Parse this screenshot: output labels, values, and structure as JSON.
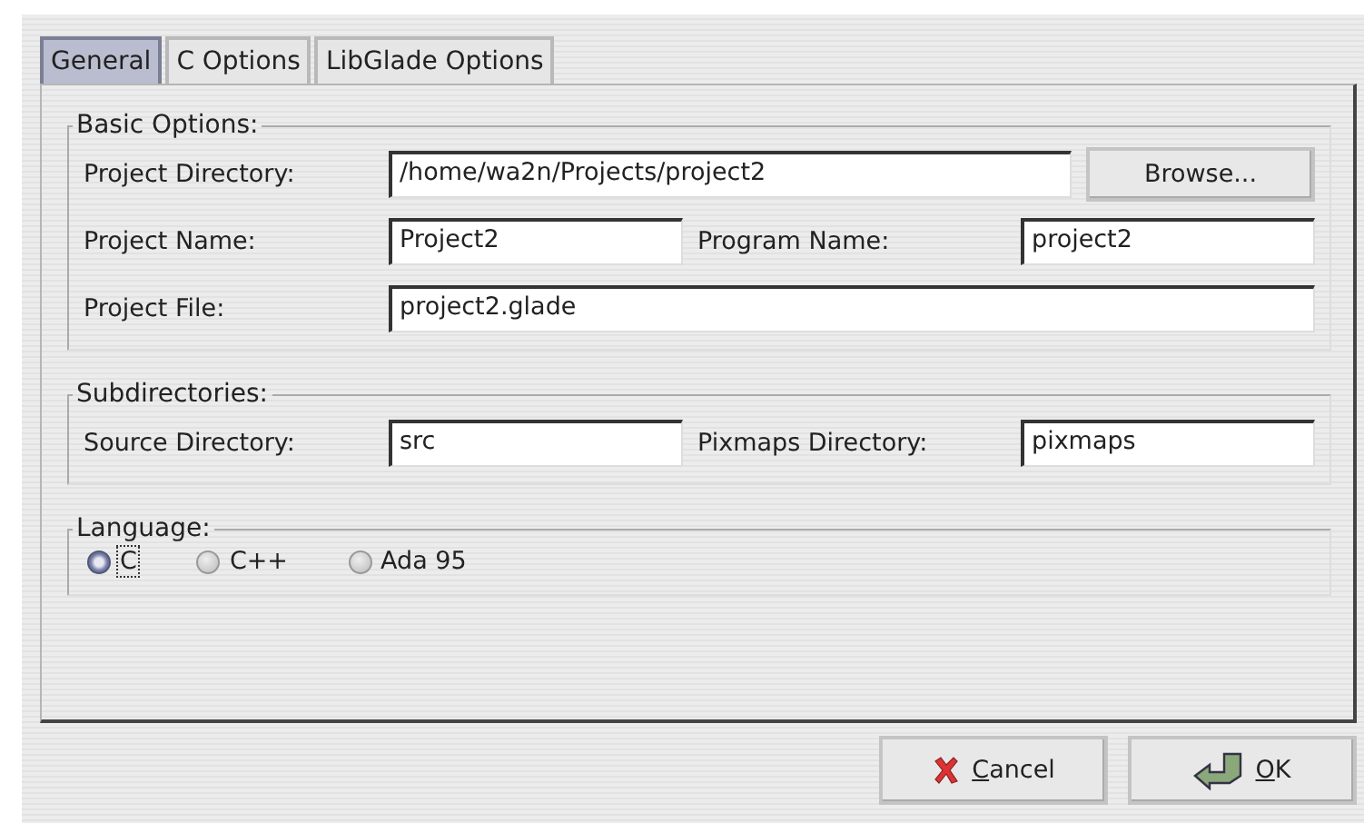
{
  "tabs": [
    {
      "label": "General",
      "selected": true
    },
    {
      "label": "C Options",
      "selected": false
    },
    {
      "label": "LibGlade Options",
      "selected": false
    }
  ],
  "basic_options": {
    "title": "Basic Options:",
    "project_directory": {
      "label": "Project Directory:",
      "value": "/home/wa2n/Projects/project2"
    },
    "browse_button": "Browse...",
    "project_name": {
      "label": "Project Name:",
      "value": "Project2"
    },
    "program_name": {
      "label": "Program Name:",
      "value": "project2"
    },
    "project_file": {
      "label": "Project File:",
      "value": "project2.glade"
    }
  },
  "subdirectories": {
    "title": "Subdirectories:",
    "source_directory": {
      "label": "Source Directory:",
      "value": "src"
    },
    "pixmaps_directory": {
      "label": "Pixmaps Directory:",
      "value": "pixmaps"
    }
  },
  "language": {
    "title": "Language:",
    "options": [
      {
        "label": "C",
        "selected": true
      },
      {
        "label": "C++",
        "selected": false
      },
      {
        "label": "Ada 95",
        "selected": false
      }
    ]
  },
  "buttons": [
    {
      "kind": "cancel",
      "label": "Cancel"
    },
    {
      "kind": "ok",
      "label": "OK"
    }
  ]
}
